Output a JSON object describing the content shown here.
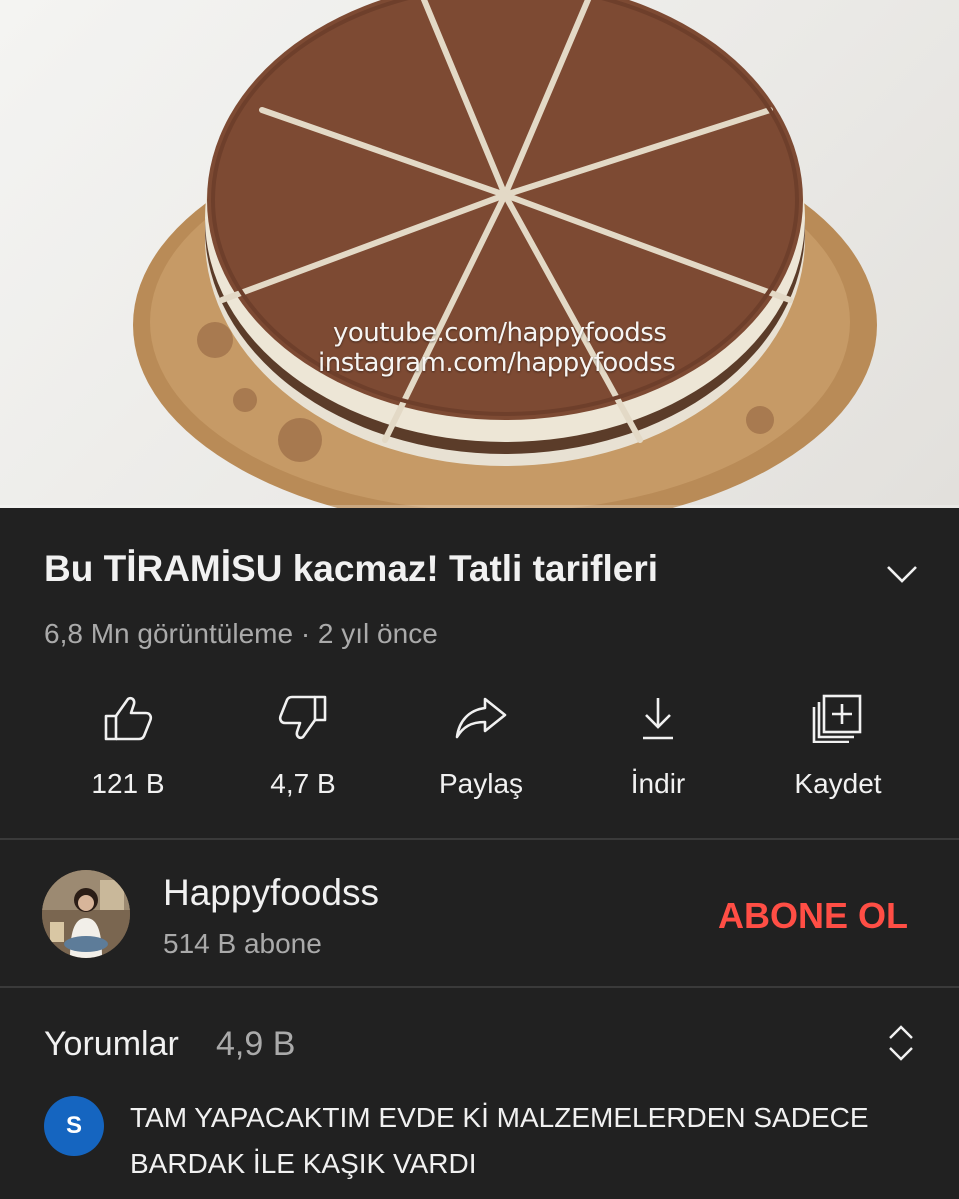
{
  "video": {
    "watermark_line1": "youtube.com/happyfoodss",
    "watermark_line2": "instagram.com/happyfoodss",
    "progress_fraction": 0
  },
  "video_title": "Bu TİRAMİSU kacmaz! Tatli tarifleri",
  "video_meta": "6,8 Mn görüntüleme · 2 yıl önce",
  "actions": {
    "like": {
      "label": "121 B",
      "icon": "thumbs-up-icon"
    },
    "dislike": {
      "label": "4,7 B",
      "icon": "thumbs-down-icon"
    },
    "share": {
      "label": "Paylaş",
      "icon": "share-icon"
    },
    "download": {
      "label": "İndir",
      "icon": "download-icon"
    },
    "save": {
      "label": "Kaydet",
      "icon": "add-to-playlist-icon"
    }
  },
  "channel": {
    "name": "Happyfoodss",
    "subscribers": "514 B abone",
    "subscribe_label": "ABONE OL"
  },
  "comments": {
    "title": "Yorumlar",
    "count": "4,9 B",
    "top_comment": {
      "avatar_letter": "S",
      "text": "TAM YAPACAKTIM EVDE Kİ MALZEMELERDEN SADECE BARDAK İLE KAŞIK VARDI"
    }
  },
  "colors": {
    "background": "#212121",
    "subscribe": "#ff4e45",
    "secondary_text": "#aaaaaa",
    "comment_avatar": "#1565c0"
  }
}
